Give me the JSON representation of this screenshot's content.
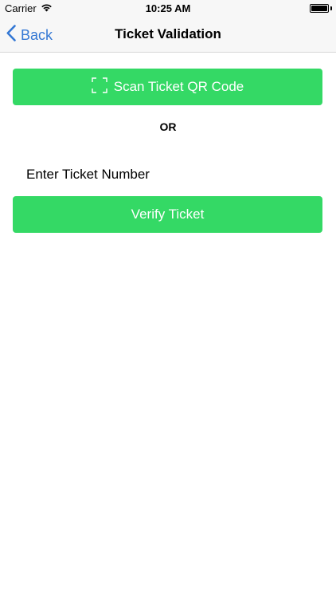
{
  "status_bar": {
    "carrier": "Carrier",
    "time": "10:25 AM",
    "icons": [
      "wifi-icon",
      "battery-icon"
    ]
  },
  "nav": {
    "back_label": "Back",
    "title": "Ticket Validation",
    "back_icon": "chevron-left-icon"
  },
  "scan": {
    "label": "Scan Ticket QR Code",
    "icon": "qr-scan-frame-icon"
  },
  "divider_label": "OR",
  "ticket_input": {
    "placeholder": "Enter Ticket Number",
    "value": ""
  },
  "verify": {
    "label": "Verify Ticket"
  },
  "colors": {
    "accent_green": "#34d965",
    "link_blue": "#3478d4",
    "bar_background": "#f7f7f7"
  }
}
